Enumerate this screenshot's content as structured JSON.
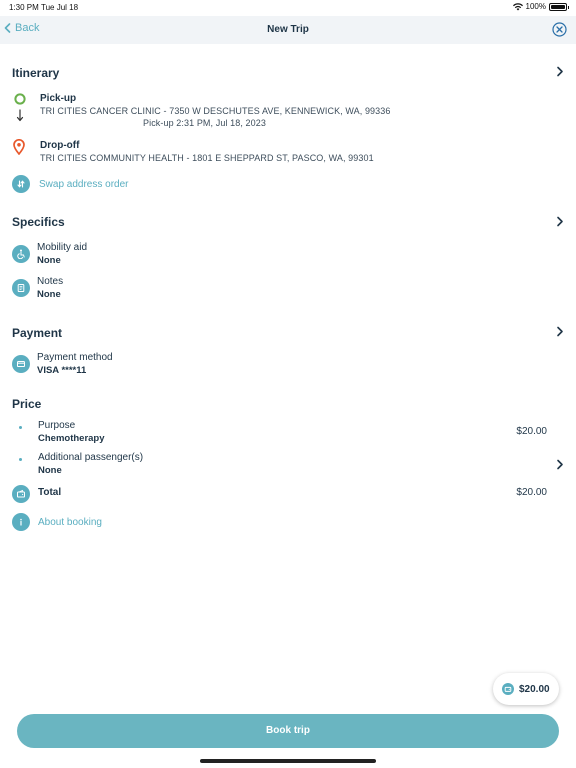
{
  "status_bar": {
    "time": "1:30 PM",
    "date": "Tue Jul 18",
    "battery": "100%"
  },
  "nav": {
    "back_label": "Back",
    "title": "New Trip"
  },
  "itinerary": {
    "title": "Itinerary",
    "pickup_label": "Pick-up",
    "pickup_address": "TRI CITIES CANCER CLINIC - 7350 W DESCHUTES AVE, KENNEWICK, WA, 99336",
    "pickup_time": "Pick-up 2:31 PM, Jul 18, 2023",
    "dropoff_label": "Drop-off",
    "dropoff_address": "TRI CITIES COMMUNITY HEALTH - 1801 E SHEPPARD ST, PASCO, WA, 99301",
    "swap_label": "Swap address order"
  },
  "specifics": {
    "title": "Specifics",
    "mobility_label": "Mobility aid",
    "mobility_value": "None",
    "notes_label": "Notes",
    "notes_value": "None"
  },
  "payment": {
    "title": "Payment",
    "method_label": "Payment method",
    "method_value": "VISA ****11"
  },
  "price": {
    "title": "Price",
    "purpose_label": "Purpose",
    "purpose_value": "Chemotherapy",
    "purpose_price": "$20.00",
    "passengers_label": "Additional passenger(s)",
    "passengers_value": "None",
    "total_label": "Total",
    "total_price": "$20.00",
    "about_label": "About booking"
  },
  "float_price": "$20.00",
  "book_button": "Book trip",
  "colors": {
    "accent": "#5aaec0",
    "button": "#6ab5c1",
    "text": "#1f3547",
    "pickup_green": "#6ab04c",
    "dropoff_orange": "#e8582c",
    "nav_bg": "#f1f4f7"
  }
}
